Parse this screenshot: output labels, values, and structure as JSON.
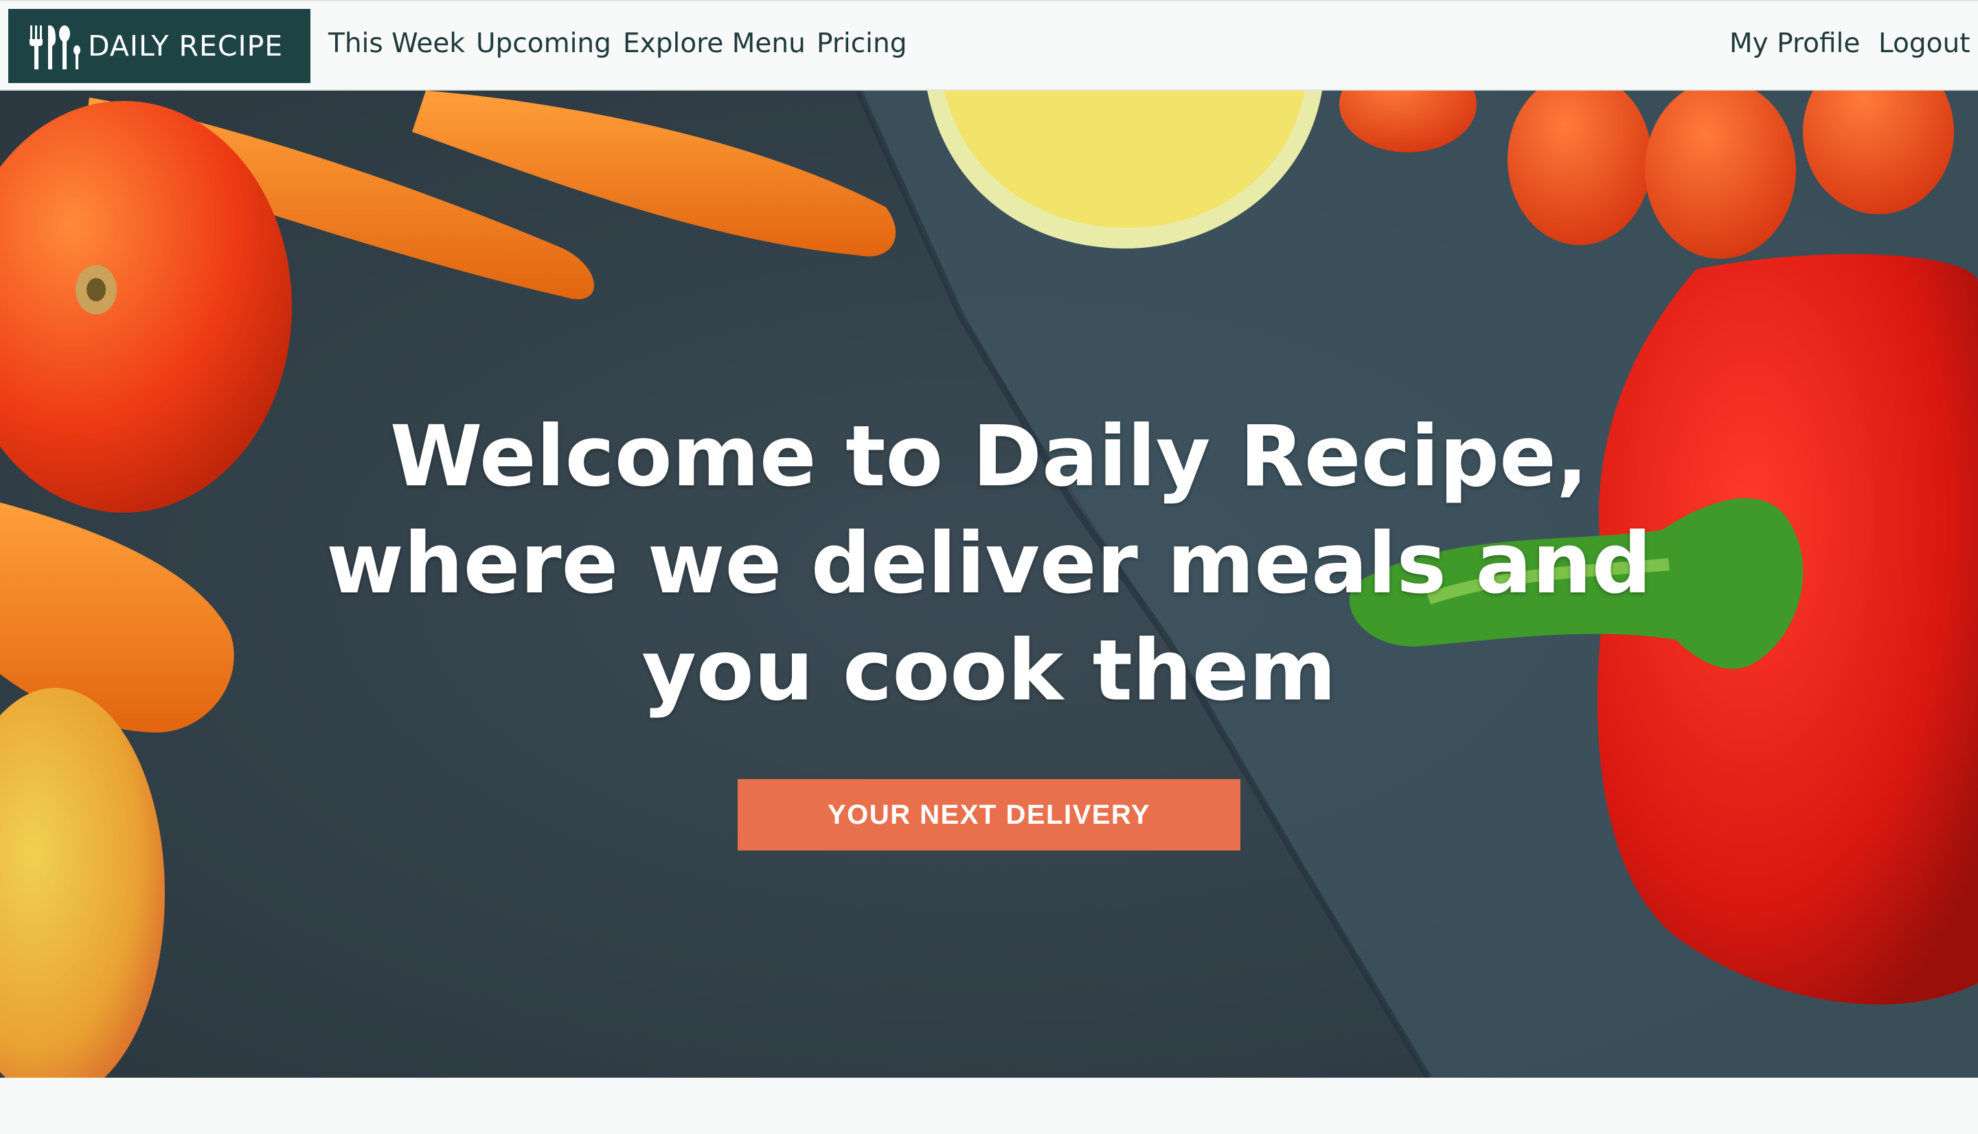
{
  "brand": {
    "name": "DAILY RECIPE",
    "icon": "cutlery-icon"
  },
  "nav": {
    "left": [
      "This Week",
      "Upcoming",
      "Explore Menu",
      "Pricing"
    ],
    "right": [
      "My Profile",
      "Logout"
    ]
  },
  "hero": {
    "headline": "Welcome to Daily Recipe, where we deliver meals and you cook them",
    "cta_label": "YOUR NEXT DELIVERY"
  },
  "colors": {
    "brand_bg": "#1d4345",
    "cta_bg": "#e8704d",
    "nav_bg": "#f8f9f9",
    "nav_text": "#1f3a3c",
    "slate": "#35434d"
  }
}
